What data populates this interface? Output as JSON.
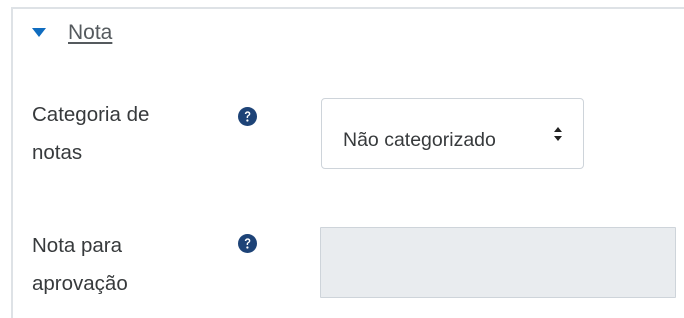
{
  "section": {
    "title": "Nota",
    "expanded": true,
    "icon": "caret-down-icon"
  },
  "fields": {
    "grade_category": {
      "label_line1": "Categoria de",
      "label_line2": "notas",
      "help_icon": "question-circle-icon",
      "selected_value": "Não categorizado"
    },
    "grade_to_pass": {
      "label_line1": "Nota para",
      "label_line2": "aprovação",
      "help_icon": "question-circle-icon",
      "value": "",
      "disabled": true
    }
  },
  "colors": {
    "accent": "#0f6cbf",
    "help_icon": "#1d4377",
    "disabled_bg": "#e9ecef",
    "border": "#ced4da"
  }
}
